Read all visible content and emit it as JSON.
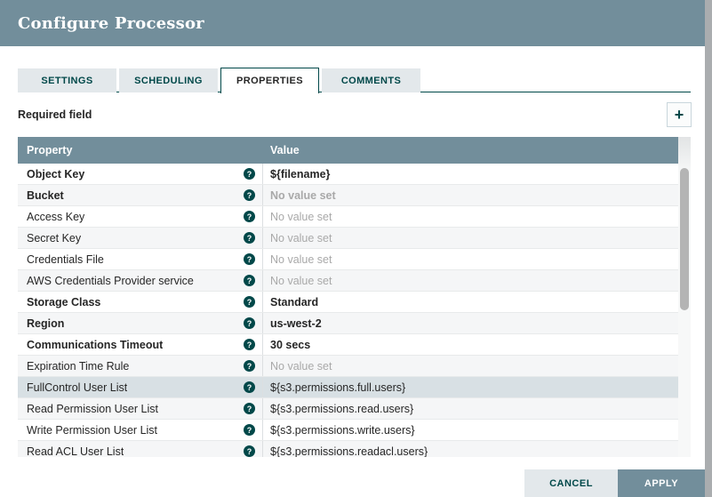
{
  "dialog": {
    "title": "Configure Processor",
    "tabs": [
      {
        "label": "SETTINGS",
        "active": false
      },
      {
        "label": "SCHEDULING",
        "active": false
      },
      {
        "label": "PROPERTIES",
        "active": true
      },
      {
        "label": "COMMENTS",
        "active": false
      }
    ],
    "required_field_label": "Required field",
    "add_button_icon": "plus-icon",
    "help_icon_glyph": "?",
    "table": {
      "columns": [
        "Property",
        "Value"
      ],
      "rows": [
        {
          "property": "Object Key",
          "required": true,
          "value": "${filename}",
          "value_set": true,
          "highlighted": false
        },
        {
          "property": "Bucket",
          "required": true,
          "value": "No value set",
          "value_set": false,
          "highlighted": false
        },
        {
          "property": "Access Key",
          "required": false,
          "value": "No value set",
          "value_set": false,
          "highlighted": false
        },
        {
          "property": "Secret Key",
          "required": false,
          "value": "No value set",
          "value_set": false,
          "highlighted": false
        },
        {
          "property": "Credentials File",
          "required": false,
          "value": "No value set",
          "value_set": false,
          "highlighted": false
        },
        {
          "property": "AWS Credentials Provider service",
          "required": false,
          "value": "No value set",
          "value_set": false,
          "highlighted": false
        },
        {
          "property": "Storage Class",
          "required": true,
          "value": "Standard",
          "value_set": true,
          "highlighted": false
        },
        {
          "property": "Region",
          "required": true,
          "value": "us-west-2",
          "value_set": true,
          "highlighted": false
        },
        {
          "property": "Communications Timeout",
          "required": true,
          "value": "30 secs",
          "value_set": true,
          "highlighted": false
        },
        {
          "property": "Expiration Time Rule",
          "required": false,
          "value": "No value set",
          "value_set": false,
          "highlighted": false
        },
        {
          "property": "FullControl User List",
          "required": false,
          "value": "${s3.permissions.full.users}",
          "value_set": true,
          "highlighted": true
        },
        {
          "property": "Read Permission User List",
          "required": false,
          "value": "${s3.permissions.read.users}",
          "value_set": true,
          "highlighted": false
        },
        {
          "property": "Write Permission User List",
          "required": false,
          "value": "${s3.permissions.write.users}",
          "value_set": true,
          "highlighted": false
        },
        {
          "property": "Read ACL User List",
          "required": false,
          "value": "${s3.permissions.readacl.users}",
          "value_set": true,
          "highlighted": false
        }
      ]
    },
    "buttons": {
      "cancel": "CANCEL",
      "apply": "APPLY"
    },
    "colors": {
      "header_bg": "#728e9b",
      "accent_teal": "#004849",
      "tab_inactive_bg": "#e3e8eb",
      "row_alt_bg": "#f5f6f7",
      "row_highlight_bg": "#d8e0e4",
      "unset_value_text": "#a9a9a9",
      "apply_bg": "#728e9b"
    }
  }
}
